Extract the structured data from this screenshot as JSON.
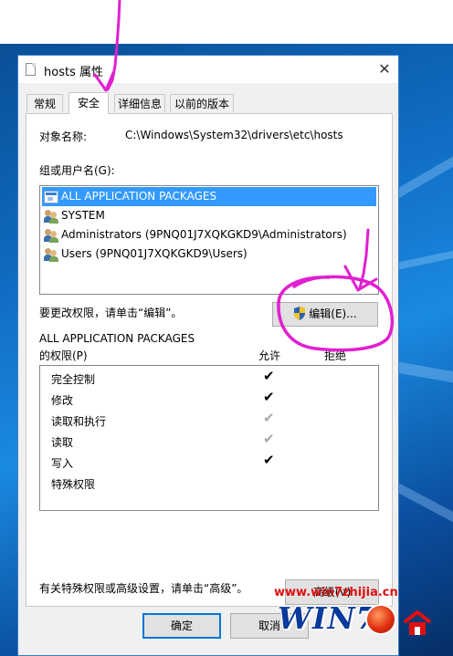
{
  "window": {
    "title": "hosts 属性",
    "close_glyph": "✕"
  },
  "tabs": [
    {
      "label": "常规",
      "active": false
    },
    {
      "label": "安全",
      "active": true
    },
    {
      "label": "详细信息",
      "active": false
    },
    {
      "label": "以前的版本",
      "active": false
    }
  ],
  "object": {
    "label": "对象名称:",
    "value": "C:\\Windows\\System32\\drivers\\etc\\hosts"
  },
  "groups": {
    "label": "组或用户名(G):",
    "items": [
      {
        "name": "ALL APPLICATION PACKAGES",
        "icon": "package-icon",
        "selected": true
      },
      {
        "name": "SYSTEM",
        "icon": "users-icon",
        "selected": false
      },
      {
        "name": "Administrators (9PNQ01J7XQKGKD9\\Administrators)",
        "icon": "users-icon",
        "selected": false
      },
      {
        "name": "Users (9PNQ01J7XQKGKD9\\Users)",
        "icon": "users-icon",
        "selected": false
      }
    ]
  },
  "edit": {
    "hint": "要更改权限，请单击“编辑”。",
    "button_label": "编辑(E)...",
    "button_icon": "uac-shield-icon"
  },
  "permissions": {
    "for_line1": "ALL APPLICATION PACKAGES",
    "for_line2": "的权限(P)",
    "allow_header": "允许",
    "deny_header": "拒绝",
    "rows": [
      {
        "name": "完全控制",
        "allow": "✔",
        "allow_state": "checked"
      },
      {
        "name": "修改",
        "allow": "✔",
        "allow_state": "checked"
      },
      {
        "name": "读取和执行",
        "allow": "✔",
        "allow_state": "inherited"
      },
      {
        "name": "读取",
        "allow": "✔",
        "allow_state": "inherited"
      },
      {
        "name": "写入",
        "allow": "✔",
        "allow_state": "checked"
      },
      {
        "name": "特殊权限",
        "allow": "",
        "allow_state": "none"
      }
    ]
  },
  "advanced": {
    "hint": "有关特殊权限或高级设置，请单击“高级”。",
    "button_label": "高级(V)"
  },
  "footer": {
    "ok_label": "确定",
    "cancel_label": "取消"
  },
  "watermark": {
    "url": "www.win7zhijia.cn",
    "logo_text": "WIN7",
    "logo_suffix": "家"
  },
  "colors": {
    "selection": "#3399ff",
    "annotation": "#e020d0",
    "watermark_red": "#e01010",
    "watermark_blue": "#0a3a9a"
  }
}
